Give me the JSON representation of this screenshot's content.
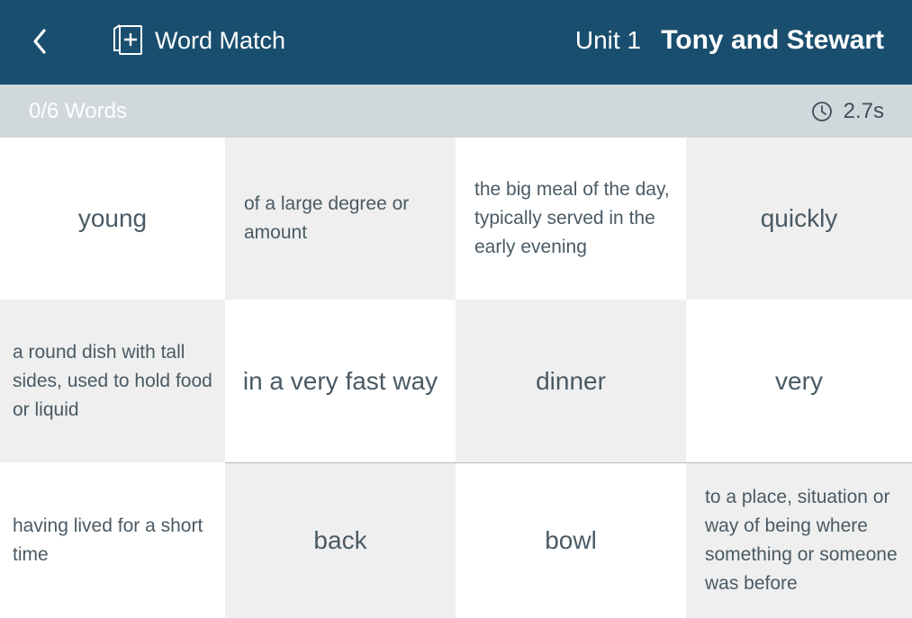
{
  "header": {
    "back_icon": "chevron-left-icon",
    "app_icon": "add-card-icon",
    "app_title": "Word Match",
    "unit": "Unit 1",
    "lesson_title": "Tony and Stewart",
    "background_color": "#1a4e6e"
  },
  "status": {
    "word_count": "0/6 Words",
    "timer_icon": "clock-icon",
    "timer": "2.7s"
  },
  "cards": [
    {
      "text": "young",
      "kind": "word"
    },
    {
      "text": "of a large degree or amount",
      "kind": "definition"
    },
    {
      "text": "the big meal of the day, typically served in the early evening",
      "kind": "definition"
    },
    {
      "text": "quickly",
      "kind": "word"
    },
    {
      "text": "a round dish with tall sides, used to hold food or liquid",
      "kind": "definition"
    },
    {
      "text": "in a very fast way",
      "kind": "word"
    },
    {
      "text": "dinner",
      "kind": "word"
    },
    {
      "text": "very",
      "kind": "word"
    },
    {
      "text": "having lived for a short time",
      "kind": "definition"
    },
    {
      "text": "back",
      "kind": "word"
    },
    {
      "text": "bowl",
      "kind": "word"
    },
    {
      "text": "to a place, situation or way of being where something or someone was before",
      "kind": "definition"
    }
  ]
}
